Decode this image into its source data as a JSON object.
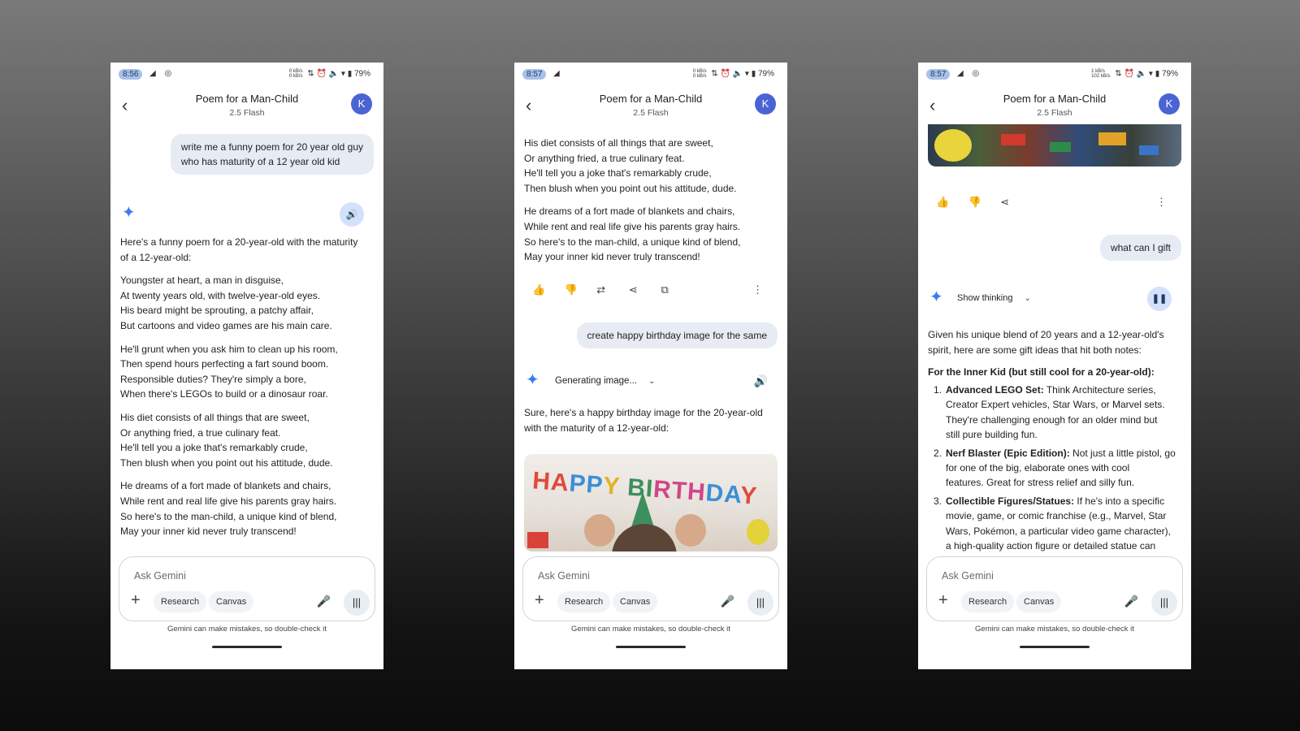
{
  "phones": [
    {
      "status": {
        "time": "8:56",
        "left_icons": "◢ ◎",
        "kbs_top": "0 kB/s",
        "kbs_bottom": "0 kB/s",
        "right_icons": "⇅ ⏰ 🔈 ▾ ▮",
        "battery": "79%"
      },
      "header": {
        "title": "Poem for a Man-Child",
        "model": "2.5 Flash",
        "avatar": "K"
      },
      "user_prompt_lines": [
        "write me a funny poem for 20 year old guy",
        "who has maturity of a 12 year old kid"
      ],
      "reply_intro_lines": [
        "Here's a funny poem for a 20-year-old with the maturity",
        "of a 12-year-old:"
      ],
      "stanzas": [
        [
          "Youngster at heart, a man in disguise,",
          "At twenty years old, with twelve-year-old eyes.",
          "His beard might be sprouting, a patchy affair,",
          "But cartoons and video games are his main care."
        ],
        [
          "He'll grunt when you ask him to clean up his room,",
          "Then spend hours perfecting a fart sound boom.",
          "Responsible duties? They're simply a bore,",
          "When there's LEGOs to build or a dinosaur roar."
        ],
        [
          "His diet consists of all things that are sweet,",
          "Or anything fried, a true culinary feat.",
          "He'll tell you a joke that's remarkably crude,",
          "Then blush when you point out his attitude, dude."
        ],
        [
          "He dreams of a fort made of blankets and chairs,",
          "While rent and real life give his parents gray hairs.",
          "So here's to the man-child, a unique kind of blend,",
          "May your inner kid never truly transcend!"
        ]
      ],
      "input": {
        "placeholder": "Ask Gemini",
        "chip_research": "Research",
        "chip_canvas": "Canvas"
      },
      "disclaimer": "Gemini can make mistakes, so double-check it"
    },
    {
      "status": {
        "time": "8:57",
        "left_icons": "◢",
        "kbs_top": "0 kB/s",
        "kbs_bottom": "0 kB/s",
        "right_icons": "⇅ ⏰ 🔈 ▾ ▮",
        "battery": "79%"
      },
      "header": {
        "title": "Poem for a Man-Child",
        "model": "2.5 Flash",
        "avatar": "K"
      },
      "stanzas": [
        [
          "His diet consists of all things that are sweet,",
          "Or anything fried, a true culinary feat.",
          "He'll tell you a joke that's remarkably crude,",
          "Then blush when you point out his attitude, dude."
        ],
        [
          "He dreams of a fort made of blankets and chairs,",
          "While rent and real life give his parents gray hairs.",
          "So here's to the man-child, a unique kind of blend,",
          "May your inner kid never truly transcend!"
        ]
      ],
      "user_prompt": "create happy birthday image for the same",
      "generating_label": "Generating image...",
      "reply_lines": [
        "Sure, here's a happy birthday image for the 20-year-old",
        "with the maturity of a 12-year-old:"
      ],
      "image_banner": "HAPPY BIRTHDAY",
      "input": {
        "placeholder": "Ask Gemini",
        "chip_research": "Research",
        "chip_canvas": "Canvas"
      },
      "disclaimer": "Gemini can make mistakes, so double-check it"
    },
    {
      "status": {
        "time": "8:57",
        "left_icons": "◢ ◎",
        "kbs_top": "1 kB/s",
        "kbs_bottom": "102 kB/s",
        "right_icons": "⇅ ⏰ 🔈 ▾ ▮",
        "battery": "79%"
      },
      "header": {
        "title": "Poem for a Man-Child",
        "model": "2.5 Flash",
        "avatar": "K"
      },
      "user_prompt": "what can I gift",
      "show_thinking": "Show thinking",
      "intro_lines": [
        "Given his unique blend of 20 years and a 12-year-old's",
        "spirit, here are some gift ideas that hit both notes:"
      ],
      "section_title": "For the Inner Kid (but still cool for a 20-year-old):",
      "gifts": [
        {
          "num": "1.",
          "name": "Advanced LEGO Set:",
          "lines": [
            "Think Architecture series,",
            "Creator Expert vehicles, Star Wars, or Marvel sets.",
            "They're challenging enough for an older mind but",
            "still pure building fun."
          ]
        },
        {
          "num": "2.",
          "name": "Nerf Blaster (Epic Edition):",
          "lines": [
            "Not just a little pistol, go",
            "for one of the big, elaborate ones with cool",
            "features. Great for stress relief and silly fun."
          ]
        },
        {
          "num": "3.",
          "name": "Collectible Figures/Statues:",
          "lines": [
            "If he's into a specific",
            "movie, game, or comic franchise (e.g., Marvel, Star",
            "Wars, Pokémon, a particular video game character),",
            "a high-quality action figure or detailed statue can"
          ]
        }
      ],
      "input": {
        "placeholder": "Ask Gemini",
        "chip_research": "Research",
        "chip_canvas": "Canvas"
      },
      "disclaimer": "Gemini can make mistakes, so double-check it"
    }
  ],
  "icons": {
    "back": "‹",
    "spark": "✦",
    "speaker": "🔊",
    "pause": "❚❚",
    "thumbs_up": "👍",
    "thumbs_down": "👎",
    "modify": "⇄",
    "share": "⋖",
    "copy": "⧉",
    "more": "⋮",
    "chevron": "⌄",
    "plus": "+",
    "mic": "🎤",
    "live": "|||"
  },
  "colors": {
    "avatar": "#4a64d4",
    "spark": "#3d7bf2",
    "user_bubble": "#e6ebf4",
    "time_pill": "#a9c1e8"
  }
}
